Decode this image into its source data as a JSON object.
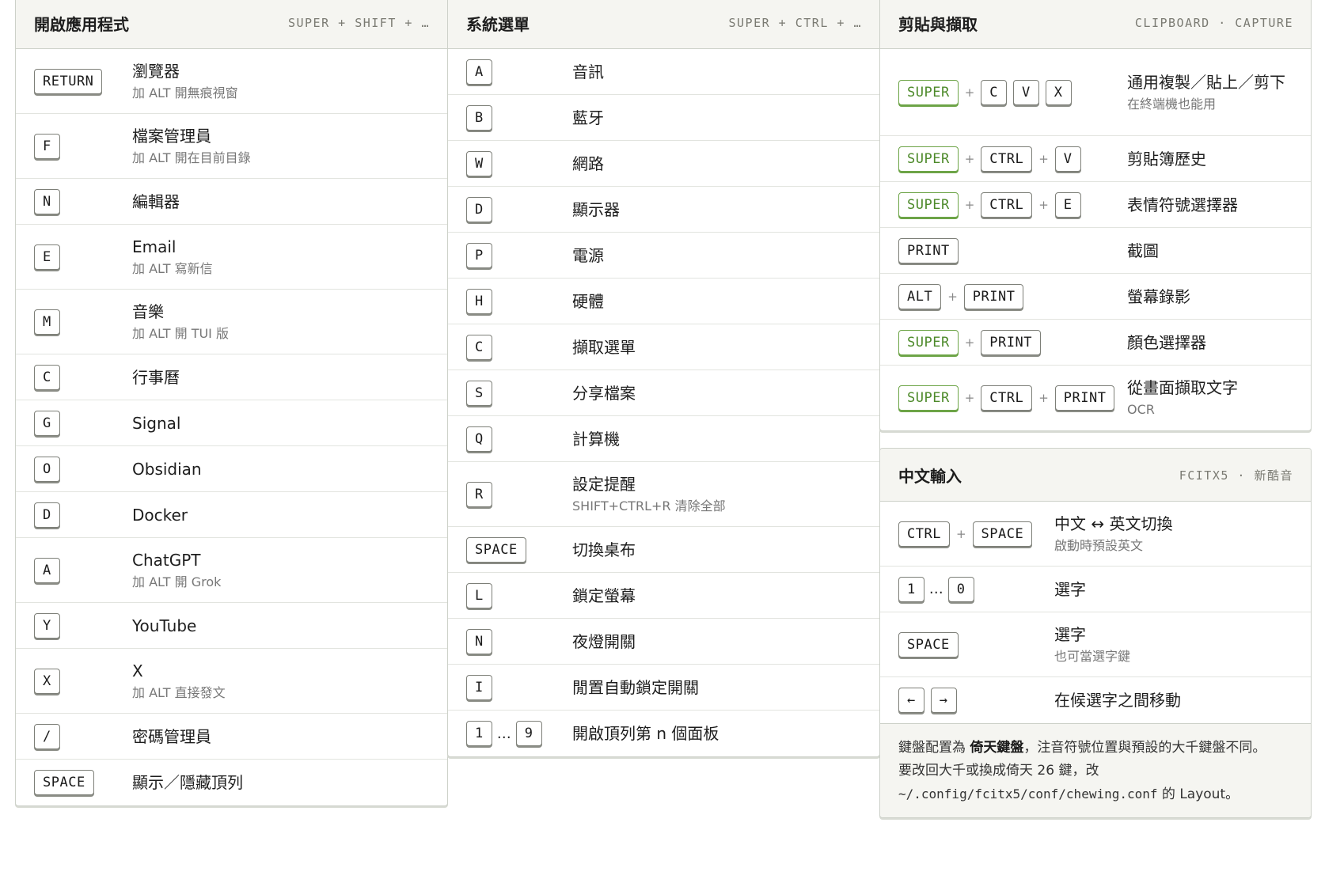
{
  "apps": {
    "title": "開啟應用程式",
    "hint": "SUPER + SHIFT + …",
    "rows": [
      {
        "keys": [
          "RETURN"
        ],
        "label": "瀏覽器",
        "sub": "加 ALT 開無痕視窗"
      },
      {
        "keys": [
          "F"
        ],
        "label": "檔案管理員",
        "sub": "加 ALT 開在目前目錄"
      },
      {
        "keys": [
          "N"
        ],
        "label": "編輯器"
      },
      {
        "keys": [
          "E"
        ],
        "label": "Email",
        "sub": "加 ALT 寫新信"
      },
      {
        "keys": [
          "M"
        ],
        "label": "音樂",
        "sub": "加 ALT 開 TUI 版"
      },
      {
        "keys": [
          "C"
        ],
        "label": "行事曆"
      },
      {
        "keys": [
          "G"
        ],
        "label": "Signal"
      },
      {
        "keys": [
          "O"
        ],
        "label": "Obsidian"
      },
      {
        "keys": [
          "D"
        ],
        "label": "Docker"
      },
      {
        "keys": [
          "A"
        ],
        "label": "ChatGPT",
        "sub": "加 ALT 開 Grok"
      },
      {
        "keys": [
          "Y"
        ],
        "label": "YouTube"
      },
      {
        "keys": [
          "X"
        ],
        "label": "X",
        "sub": "加 ALT 直接發文"
      },
      {
        "keys": [
          "/"
        ],
        "label": "密碼管理員"
      },
      {
        "keys": [
          "SPACE"
        ],
        "label": "顯示／隱藏頂列"
      }
    ]
  },
  "system": {
    "title": "系統選單",
    "hint": "SUPER + CTRL + …",
    "rows": [
      {
        "keys": [
          "A"
        ],
        "label": "音訊"
      },
      {
        "keys": [
          "B"
        ],
        "label": "藍牙"
      },
      {
        "keys": [
          "W"
        ],
        "label": "網路"
      },
      {
        "keys": [
          "D"
        ],
        "label": "顯示器"
      },
      {
        "keys": [
          "P"
        ],
        "label": "電源"
      },
      {
        "keys": [
          "H"
        ],
        "label": "硬體"
      },
      {
        "keys": [
          "C"
        ],
        "label": "擷取選單"
      },
      {
        "keys": [
          "S"
        ],
        "label": "分享檔案"
      },
      {
        "keys": [
          "Q"
        ],
        "label": "計算機"
      },
      {
        "keys": [
          "R"
        ],
        "label": "設定提醒",
        "sub": "SHIFT+CTRL+R 清除全部"
      },
      {
        "keys": [
          "SPACE"
        ],
        "label": "切換桌布"
      },
      {
        "keys": [
          "L"
        ],
        "label": "鎖定螢幕"
      },
      {
        "keys": [
          "N"
        ],
        "label": "夜燈開關"
      },
      {
        "keys": [
          "I"
        ],
        "label": "閒置自動鎖定開關"
      },
      {
        "keys": [
          "1",
          "…",
          "9"
        ],
        "range": true,
        "label": "開啟頂列第 n 個面板"
      }
    ]
  },
  "clipboard": {
    "title": "剪貼與擷取",
    "hint": "CLIPBOARD · CAPTURE",
    "rows": [
      {
        "keys": [
          "SUPER",
          "+",
          "C",
          "V",
          "X"
        ],
        "label": "通用複製／貼上／剪下",
        "sub": "在終端機也能用"
      },
      {
        "keys": [
          "SUPER",
          "+",
          "CTRL",
          "+",
          "V"
        ],
        "label": "剪貼簿歷史"
      },
      {
        "keys": [
          "SUPER",
          "+",
          "CTRL",
          "+",
          "E"
        ],
        "label": "表情符號選擇器"
      },
      {
        "keys": [
          "PRINT"
        ],
        "label": "截圖"
      },
      {
        "keys": [
          "ALT",
          "+",
          "PRINT"
        ],
        "label": "螢幕錄影"
      },
      {
        "keys": [
          "SUPER",
          "+",
          "PRINT"
        ],
        "label": "顏色選擇器"
      },
      {
        "keys": [
          "SUPER",
          "+",
          "CTRL",
          "+",
          "PRINT"
        ],
        "label": "從畫面擷取文字",
        "sub": "OCR"
      }
    ]
  },
  "ime": {
    "title": "中文輸入",
    "hint": "FCITX5 · 新酷音",
    "rows": [
      {
        "keys": [
          "CTRL",
          "+",
          "SPACE"
        ],
        "label": "中文 ↔ 英文切換",
        "sub": "啟動時預設英文"
      },
      {
        "keys": [
          "1",
          "…",
          "0"
        ],
        "range": true,
        "label": "選字"
      },
      {
        "keys": [
          "SPACE"
        ],
        "label": "選字",
        "sub": "也可當選字鍵"
      },
      {
        "keys": [
          "←",
          "→"
        ],
        "label": "在候選字之間移動"
      }
    ],
    "note": {
      "line1_pre": "鍵盤配置為 ",
      "line1_bold": "倚天鍵盤",
      "line1_post": "，注音符號位置與預設的大千鍵盤不同。",
      "line2": "要改回大千或換成倚天 26 鍵，改",
      "path": "~/.config/fcitx5/conf/chewing.conf",
      "line3_mid": " 的 ",
      "line3_tail": "Layout",
      "line3_end": "。"
    }
  },
  "colors": {
    "super_key": "#4d8a2a",
    "header_bg": "#f5f5f1",
    "border": "#cdd1c9"
  }
}
